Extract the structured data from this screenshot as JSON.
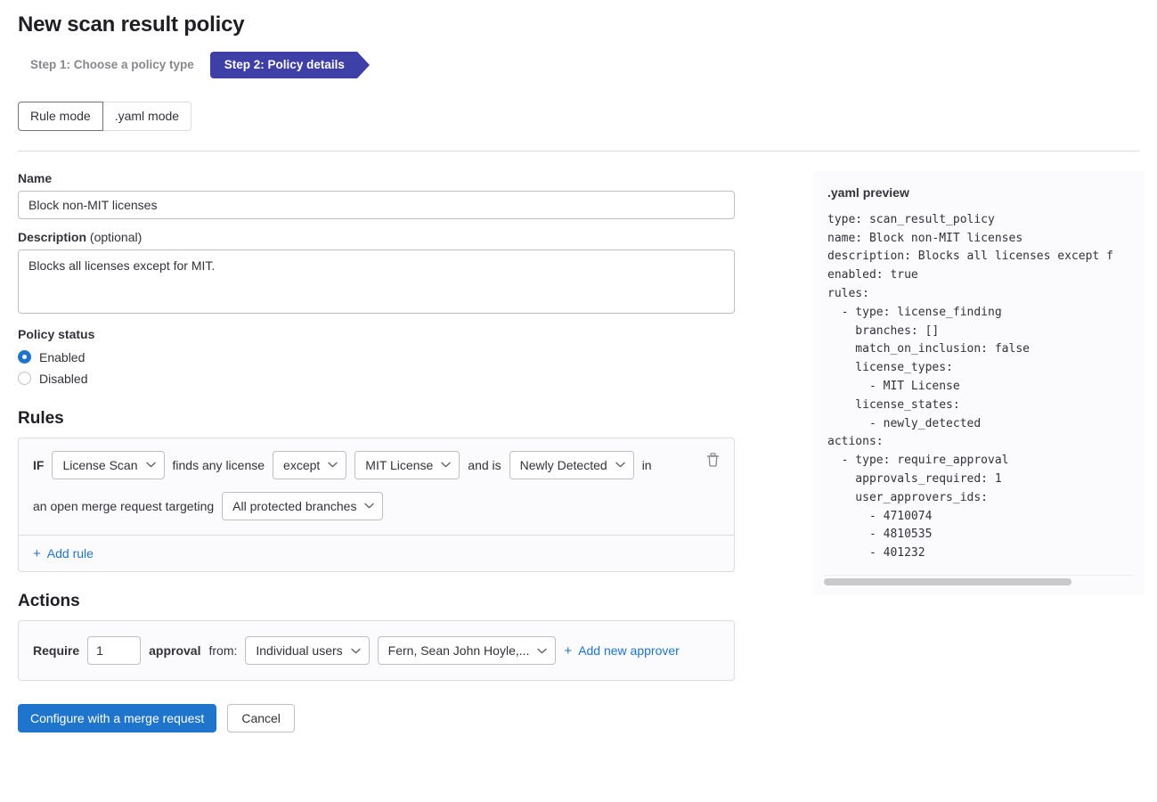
{
  "header": {
    "title": "New scan result policy",
    "steps": [
      {
        "label": "Step 1: Choose a policy type",
        "active": false
      },
      {
        "label": "Step 2: Policy details",
        "active": true
      }
    ]
  },
  "mode_toggle": {
    "rule_mode_label": "Rule mode",
    "yaml_mode_label": ".yaml mode",
    "selected": "Rule mode"
  },
  "form": {
    "name_label": "Name",
    "name_value": "Block non-MIT licenses",
    "name_placeholder": "",
    "description_label": "Description",
    "description_optional": " (optional)",
    "description_value": "Blocks all licenses except for MIT.",
    "description_placeholder": "",
    "policy_status_label": "Policy status",
    "status_options": [
      {
        "label": "Enabled",
        "checked": true
      },
      {
        "label": "Disabled",
        "checked": false
      }
    ]
  },
  "rules": {
    "heading": "Rules",
    "if_label": "IF",
    "scanner_dropdown": "License Scan",
    "finds_text": "finds any license",
    "match_dropdown": "except",
    "license_dropdown": "MIT License",
    "and_is_text": "and is",
    "state_dropdown": "Newly Detected",
    "in_text": "in",
    "merge_request_text": "an open merge request targeting",
    "branches_dropdown": "All protected branches",
    "add_rule_label": "Add rule",
    "delete_icon": "trash-icon"
  },
  "actions": {
    "heading": "Actions",
    "require_label": "Require",
    "approvals_value": "1",
    "approval_label": "approval",
    "from_label": "from:",
    "approver_type_dropdown": "Individual users",
    "approvers_dropdown": "Fern, Sean John Hoyle,...",
    "add_approver_label": "Add new approver"
  },
  "footer": {
    "primary_label": "Configure with a merge request",
    "cancel_label": "Cancel"
  },
  "yaml_preview": {
    "title": ".yaml preview",
    "content": "type: scan_result_policy\nname: Block non-MIT licenses\ndescription: Blocks all licenses except f\nenabled: true\nrules:\n  - type: license_finding\n    branches: []\n    match_on_inclusion: false\n    license_types:\n      - MIT License\n    license_states:\n      - newly_detected\nactions:\n  - type: require_approval\n    approvals_required: 1\n    user_approvers_ids:\n      - 4710074\n      - 4810535\n      - 401232",
    "scroll_thumb_percent": 80
  },
  "colors": {
    "accent_blue": "#1f75cb",
    "step_active": "#3f3fa8",
    "panel_bg": "#fbfafd",
    "border": "#dcdcde"
  }
}
